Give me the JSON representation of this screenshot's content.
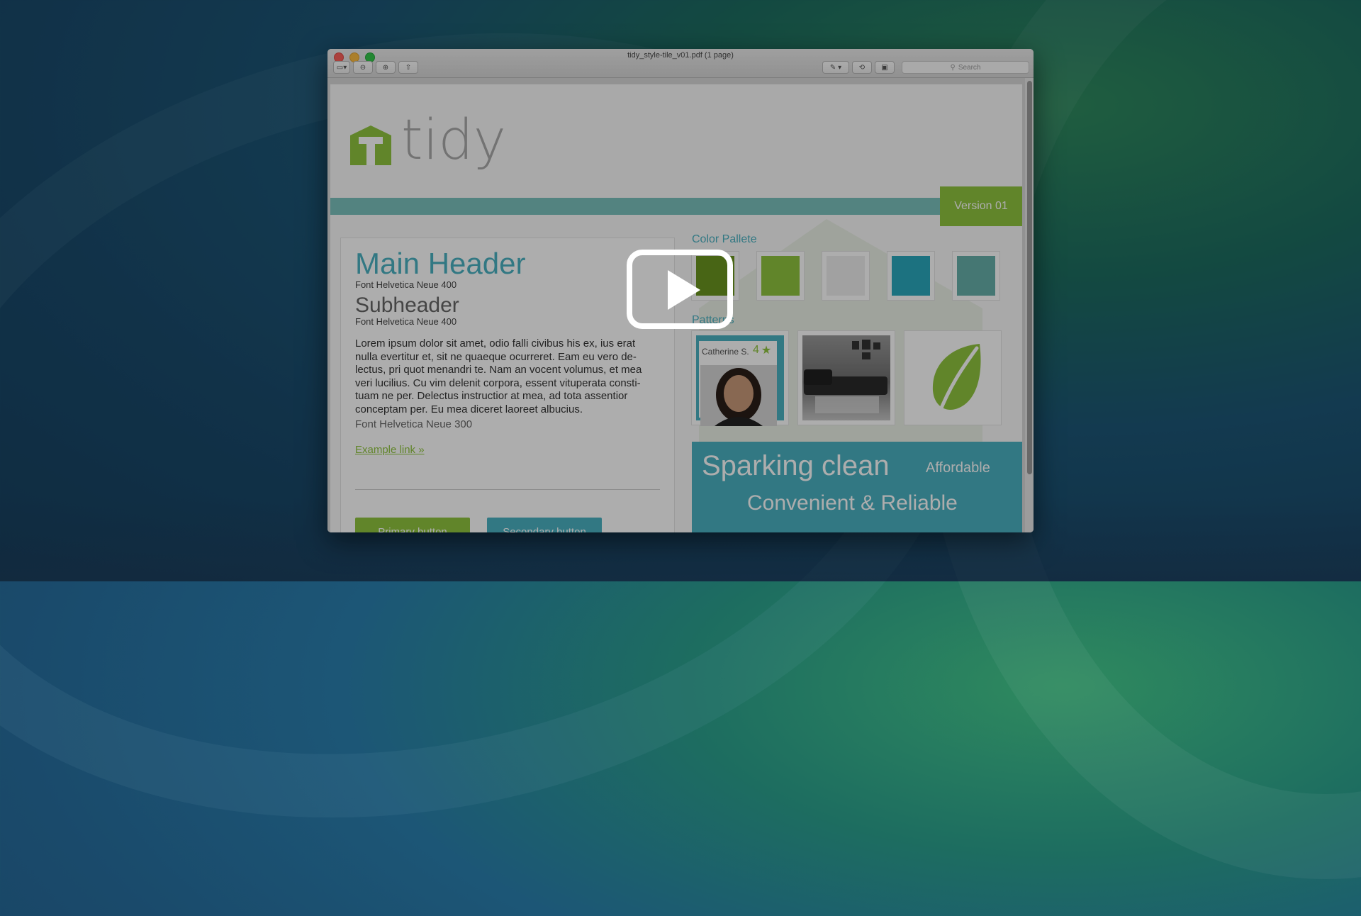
{
  "window": {
    "title": "tidy_style-tile_v01.pdf (1 page)",
    "search_placeholder": "Search"
  },
  "document": {
    "brand": "tidy",
    "brand_initial": "T",
    "version_label": "Version 01",
    "main_header": "Main Header",
    "main_header_note": "Font Helvetica Neue 400",
    "subheader": "Subheader",
    "subheader_note": "Font Helvetica Neue 400",
    "body_text": "Lorem ipsum dolor sit amet, odio falli civibus his ex, ius erat nulla evertitur et, sit ne quaeque ocurreret. Eam eu vero de-lectus, pri quot menandri te. Nam an vocent volumus, et mea veri lucilius. Cu vim delenit corpora, essent vituperata consti-tuam ne per. Delectus instructior at mea, ad tota assentior conceptam per. Eu mea diceret laoreet albucius.",
    "body_note": "Font Helvetica Neue 300",
    "example_link": "Example link »",
    "primary_button": "Primary button",
    "secondary_button": "Secondary button",
    "palette_title": "Color Pallete",
    "patterns_title": "Patterns",
    "review_name": "Catherine S.",
    "review_score": "4",
    "promo_big": "Sparking clean",
    "promo_affordable": "Affordable",
    "promo_convenient": "Convenient & Reliable"
  },
  "colors": {
    "palette": [
      "#6a961f",
      "#8fc43f",
      "#eeeeee",
      "#2aa8bd",
      "#66b0aa"
    ],
    "brand_green": "#8fc43f",
    "brand_teal": "#4ab1c1"
  },
  "icons": [
    "sidebar-icon",
    "zoom-out-icon",
    "zoom-in-icon",
    "share-icon",
    "pen-icon",
    "rotate-icon",
    "toolbox-icon",
    "search-icon",
    "star-icon",
    "leaf-icon",
    "play-icon"
  ]
}
